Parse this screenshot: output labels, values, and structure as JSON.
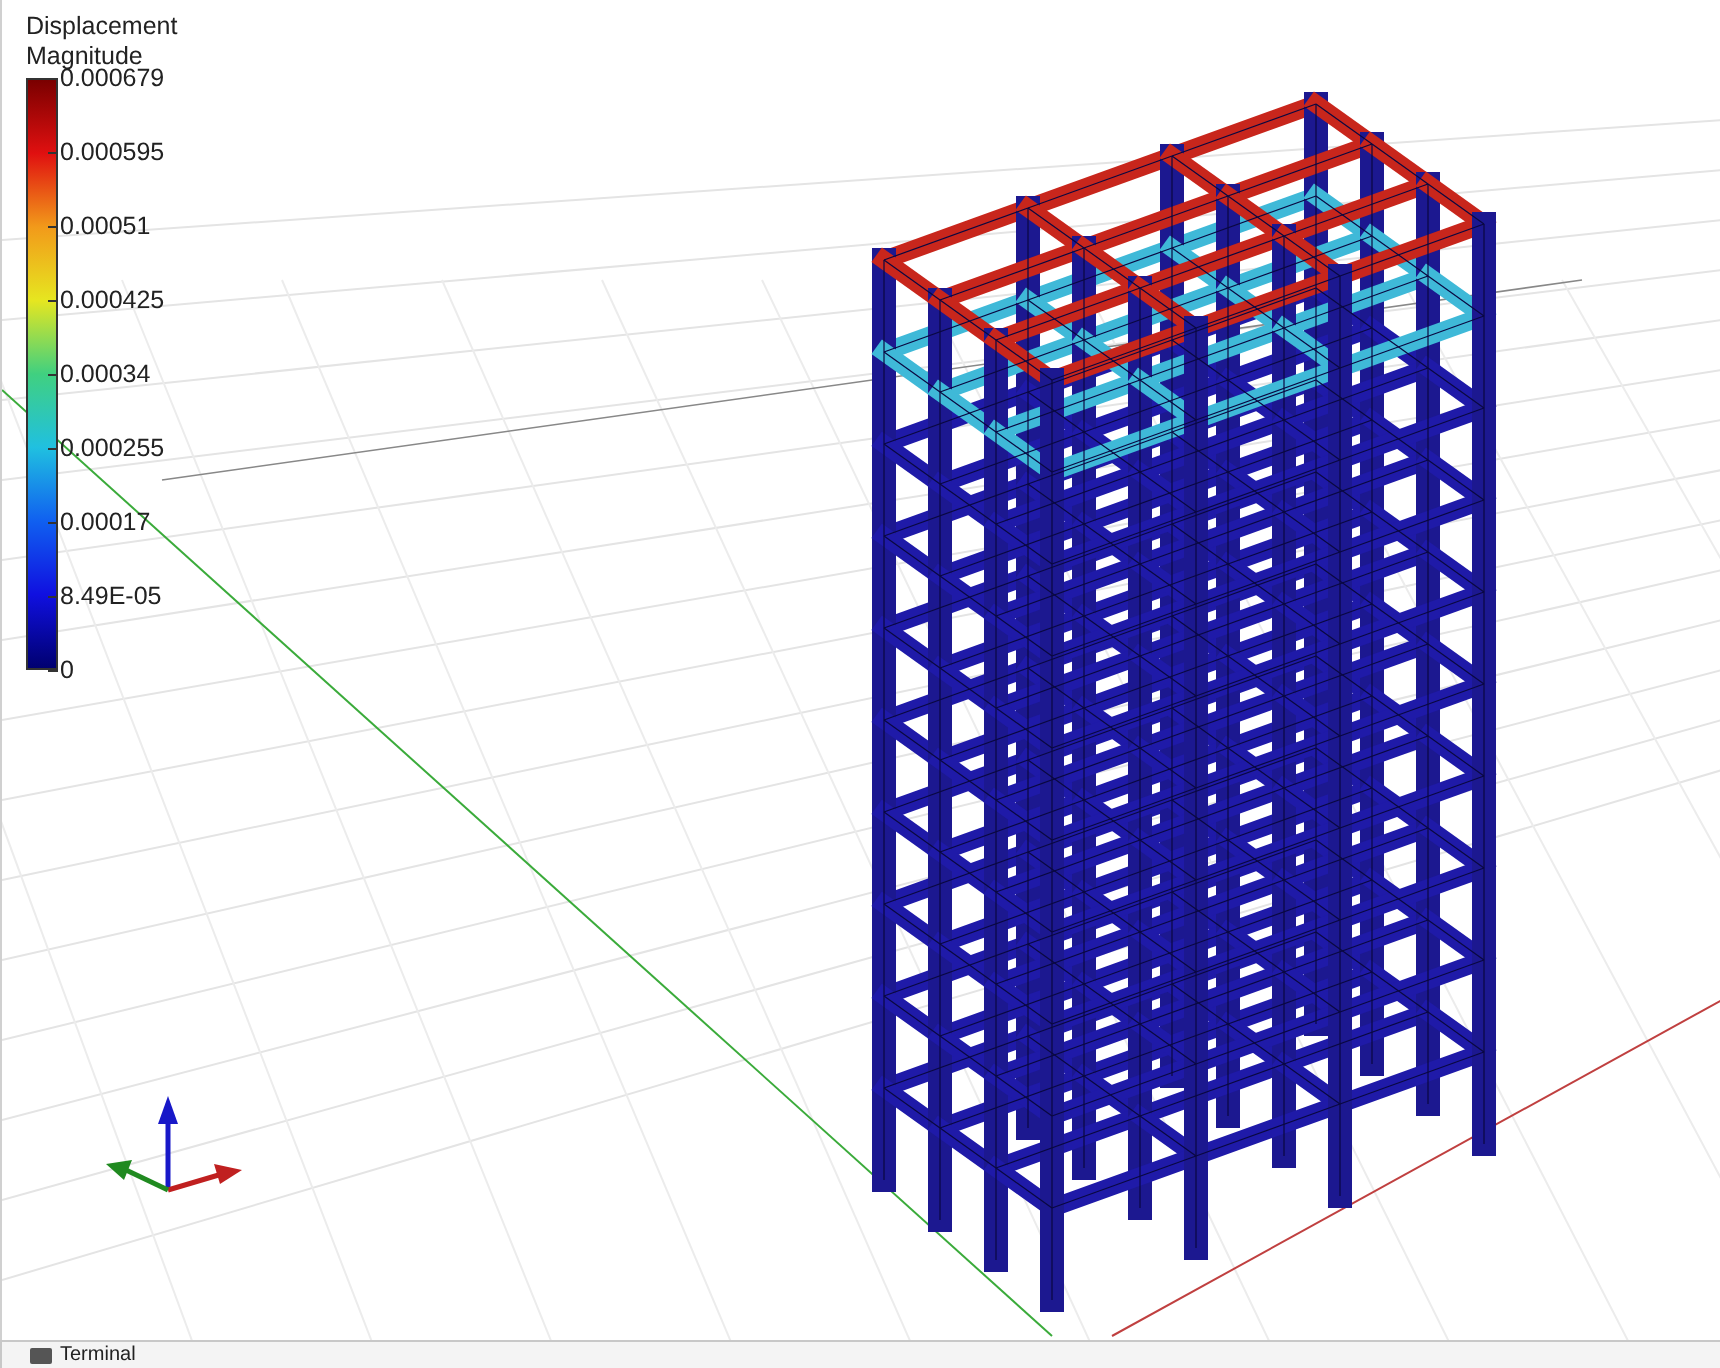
{
  "legend": {
    "title_lines": [
      "Displacement",
      "Magnitude"
    ],
    "ticks": [
      "0.000679",
      "0.000595",
      "0.00051",
      "0.000425",
      "0.00034",
      "0.000255",
      "0.00017",
      "8.49E-05",
      "0"
    ]
  },
  "bottom_panel": {
    "tab_label": "Terminal"
  }
}
